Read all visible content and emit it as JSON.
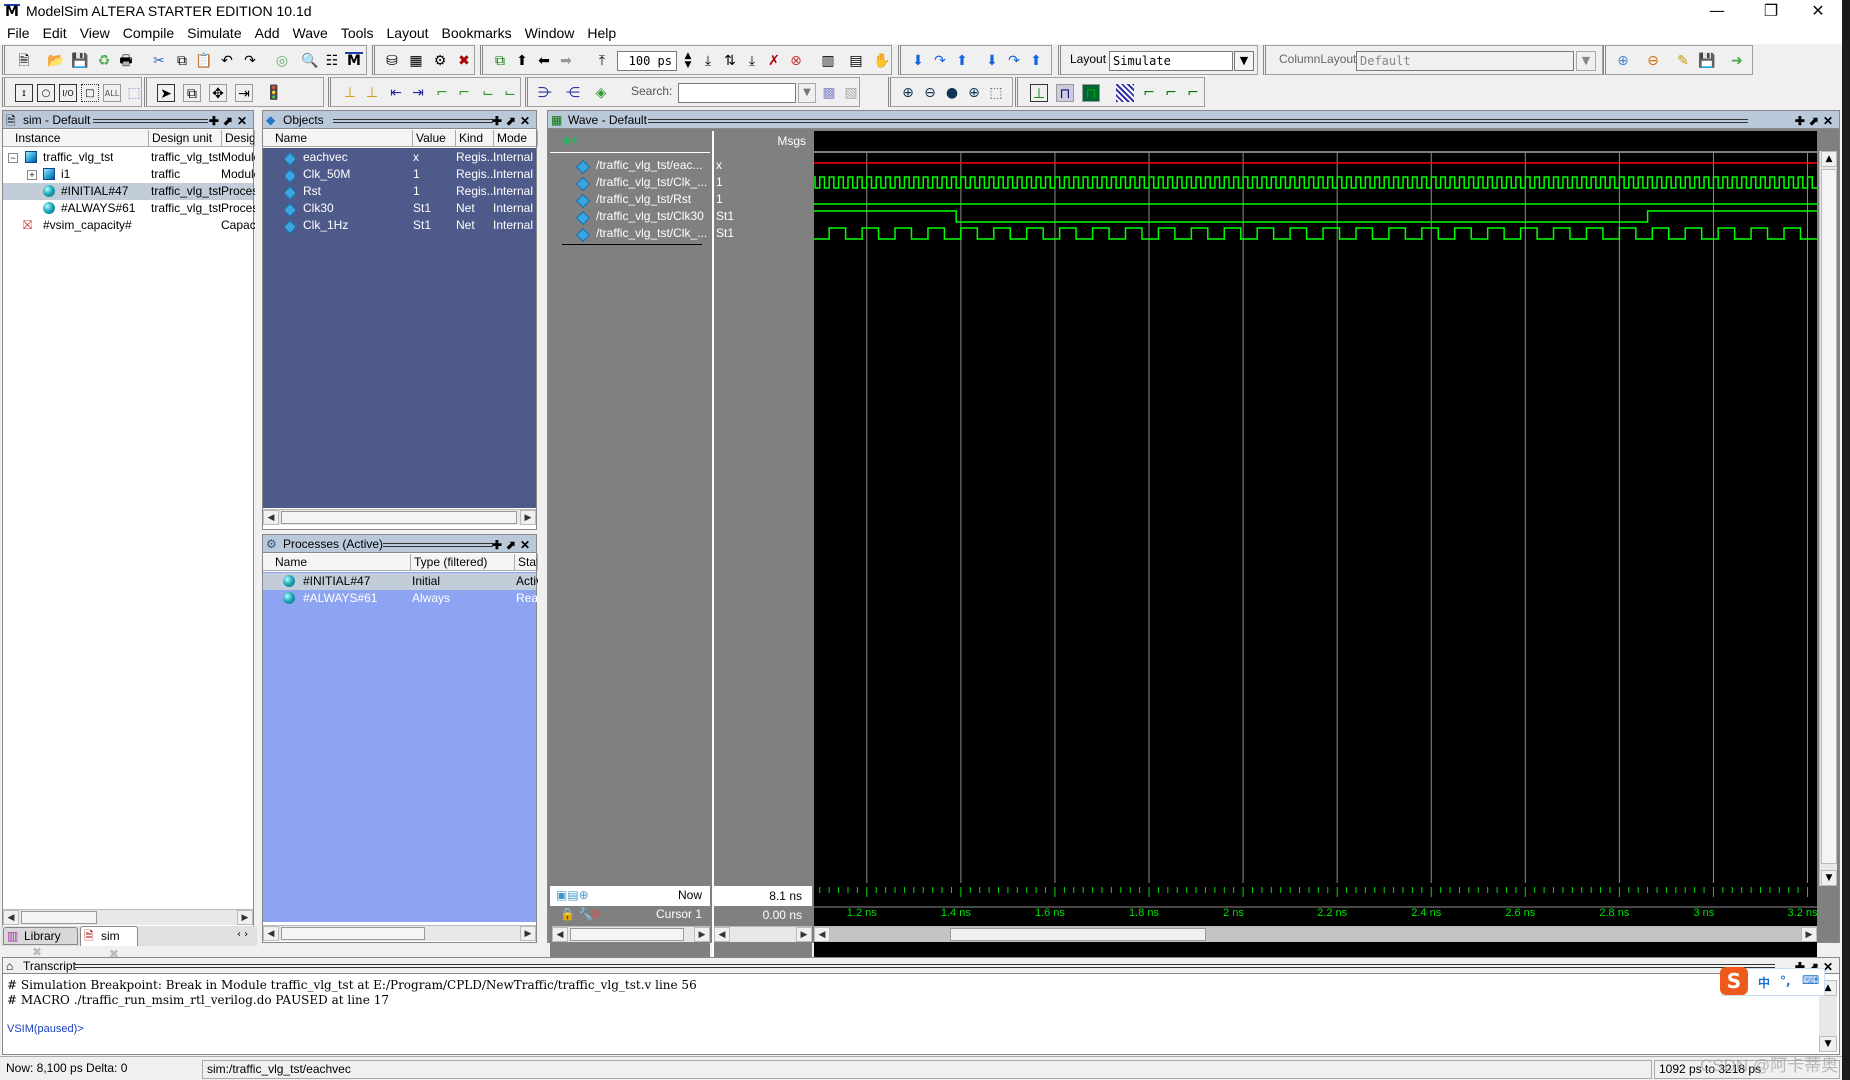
{
  "window": {
    "title": "ModelSim ALTERA STARTER EDITION 10.1d",
    "logo_letter": "M",
    "controls": {
      "minimize": "—",
      "restore": "❐",
      "close": "✕"
    }
  },
  "menu": [
    "File",
    "Edit",
    "View",
    "Compile",
    "Simulate",
    "Add",
    "Wave",
    "Tools",
    "Layout",
    "Bookmarks",
    "Window",
    "Help"
  ],
  "toolbar": {
    "run_length": "100 ps",
    "layout_label": "Layout",
    "layout_value": "Simulate",
    "column_layout_label": "ColumnLayout",
    "column_layout_value": "Default",
    "search_label": "Search:",
    "search_value": ""
  },
  "sim_panel": {
    "title": "sim - Default",
    "columns": [
      "Instance",
      "Design unit",
      "Design"
    ],
    "rows": [
      {
        "expander": "−",
        "icon": "module-icon",
        "name": "traffic_vlg_tst",
        "unit": "traffic_vlg_tst",
        "type": "Module",
        "level": 0
      },
      {
        "expander": "+",
        "icon": "module-icon",
        "name": "i1",
        "unit": "traffic",
        "type": "Module",
        "level": 1
      },
      {
        "expander": "",
        "icon": "process-icon",
        "name": "#INITIAL#47",
        "unit": "traffic_vlg_tst",
        "type": "Process",
        "level": 1,
        "selected": true
      },
      {
        "expander": "",
        "icon": "process-icon",
        "name": "#ALWAYS#61",
        "unit": "traffic_vlg_tst",
        "type": "Process",
        "level": 1
      },
      {
        "expander": "",
        "icon": "capacity-icon",
        "name": "#vsim_capacity#",
        "unit": "",
        "type": "Capacity",
        "level": 0
      }
    ],
    "tabs": [
      {
        "label": "Library"
      },
      {
        "label": "sim",
        "active": true
      }
    ]
  },
  "objects_panel": {
    "title": "Objects",
    "columns": [
      "Name",
      "Value",
      "Kind",
      "Mode"
    ],
    "rows": [
      {
        "name": "eachvec",
        "value": "x",
        "kind": "Regis...",
        "mode": "Internal"
      },
      {
        "name": "Clk_50M",
        "value": "1",
        "kind": "Regis...",
        "mode": "Internal"
      },
      {
        "name": "Rst",
        "value": "1",
        "kind": "Regis...",
        "mode": "Internal"
      },
      {
        "name": "Clk30",
        "value": "St1",
        "kind": "Net",
        "mode": "Internal"
      },
      {
        "name": "Clk_1Hz",
        "value": "St1",
        "kind": "Net",
        "mode": "Internal"
      }
    ]
  },
  "processes_panel": {
    "title": "Processes (Active)",
    "columns": [
      "Name",
      "Type (filtered)",
      "State"
    ],
    "rows": [
      {
        "name": "#INITIAL#47",
        "type": "Initial",
        "state": "Active"
      },
      {
        "name": "#ALWAYS#61",
        "type": "Always",
        "state": "Ready"
      }
    ]
  },
  "wave_panel": {
    "title": "Wave - Default",
    "msgs_header": "Msgs",
    "signals": [
      {
        "name": "/traffic_vlg_tst/eac...",
        "value": "x",
        "color": "#ff0000",
        "kind": "flat"
      },
      {
        "name": "/traffic_vlg_tst/Clk_...",
        "value": "1",
        "color": "#00ff00",
        "kind": "fastclock"
      },
      {
        "name": "/traffic_vlg_tst/Rst",
        "value": "1",
        "color": "#00ff00",
        "kind": "high"
      },
      {
        "name": "/traffic_vlg_tst/Clk30",
        "value": "St1",
        "color": "#00ff00",
        "kind": "step",
        "low_from_ns": 1.39,
        "high_from_ns": 2.86
      },
      {
        "name": "/traffic_vlg_tst/Clk_...",
        "value": "St1",
        "color": "#00ff00",
        "kind": "slowclock"
      }
    ],
    "now_label": "Now",
    "now_value": "8.1 ns",
    "cursor_label": "Cursor 1",
    "cursor_value": "0.00 ns",
    "time_ticks": [
      "1.2 ns",
      "1.4 ns",
      "1.6 ns",
      "1.8 ns",
      "2 ns",
      "2.2 ns",
      "2.4 ns",
      "2.6 ns",
      "2.8 ns",
      "3 ns",
      "3.2 ns"
    ],
    "view_range_ps": [
      1092,
      3218
    ]
  },
  "transcript": {
    "title": "Transcript",
    "lines": [
      "# Simulation Breakpoint: Break in Module traffic_vlg_tst at E:/Program/CPLD/NewTraffic/traffic_vlg_tst.v line 56",
      "# MACRO ./traffic_run_msim_rtl_verilog.do PAUSED at line 17"
    ],
    "prompt": "VSIM(paused)>"
  },
  "ime": {
    "mode": "中",
    "punct": "°,",
    "keyboard": "⌨"
  },
  "statusbar": {
    "now": "Now: 8,100 ps  Delta: 0",
    "path": "sim:/traffic_vlg_tst/eachvec",
    "range": "1092 ps to 3218 ps"
  },
  "watermark": "CSDN @阿卡蒂奥"
}
